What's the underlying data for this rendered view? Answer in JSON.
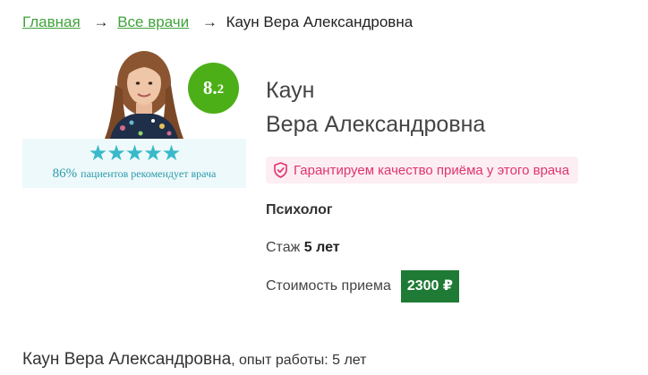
{
  "breadcrumb": {
    "home": "Главная",
    "all_doctors": "Все врачи",
    "arrow": "→",
    "current": "Каун Вера Александровна"
  },
  "doctor": {
    "last_name": "Каун",
    "first_names": "Вера Александровна",
    "score_int": "8.",
    "score_frac": "2",
    "stars": "★★★★★",
    "recommend_pct": "86%",
    "recommend_text": "пациентов рекомендует врача",
    "guarantee": "Гарантируем качество приёма у этого врача",
    "specialty": "Психолог",
    "experience_label": "Стаж",
    "experience_value": "5 лет",
    "price_label": "Стоимость приема",
    "price": "2300 ₽"
  },
  "summary": {
    "name": "Каун Вера Александровна",
    "rest": ", опыт работы: 5 лет"
  },
  "colors": {
    "link": "#3fa33a",
    "score_bg": "#4caf18",
    "stars": "#39b9c9",
    "guarantee_text": "#e0336f",
    "guarantee_bg": "#fdeef3",
    "price_bg": "#1f7a35"
  },
  "icons": {
    "guarantee": "shield-check-icon",
    "doctor_photo": "doctor-photo"
  }
}
